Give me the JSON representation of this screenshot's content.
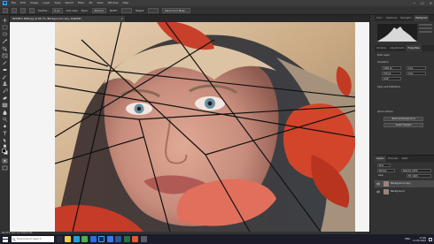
{
  "menubar": {
    "logo": "Ps",
    "items": [
      "File",
      "Edit",
      "Image",
      "Layer",
      "Type",
      "Select",
      "Filter",
      "3D",
      "View",
      "Window",
      "Help"
    ],
    "window_controls": [
      "─",
      "☐",
      "✕"
    ]
  },
  "options": {
    "feather": "Feather:",
    "feather_value": "0 px",
    "anti_alias": "Anti-alias",
    "style_label": "Style:",
    "style_value": "Normal",
    "width_label": "Width:",
    "height_label": "Height:",
    "select_mask": "Select and Mask..."
  },
  "document": {
    "tab_label": "MODELS NEW.jpg @ 66.7% (Background copy, RGB/8#)",
    "close": "×"
  },
  "status": {
    "text": "66.67%   Doc: 6.17M/12.3M"
  },
  "panels": {
    "top_tabs": [
      "Color",
      "Swatches",
      "Navigator",
      "Histogram"
    ],
    "mid_tabs": [
      "Libraries",
      "Adjustments",
      "Properties"
    ],
    "properties_title": "Pixel Layer",
    "transform_label": "Transform",
    "w_value": "1280 px",
    "h_value": "720 px",
    "x_value": "0 px",
    "y_value": "0 px",
    "angle_value": "0.00°",
    "align_label": "Align and Distribute",
    "quick_actions": "Quick Actions",
    "remove_bg": "Remove Background",
    "select_subject": "Select Subject"
  },
  "layers": {
    "tabs": [
      "Layers",
      "Channels",
      "Paths"
    ],
    "kind": "Kind",
    "blend": "Normal",
    "opacity": "Opacity: 100%",
    "lock": "Lock:",
    "fill": "Fill: 100%",
    "rows": [
      {
        "name": "Background copy"
      },
      {
        "name": "Background"
      }
    ]
  },
  "taskbar": {
    "search_placeholder": "Type here to search",
    "time": "17:46",
    "date": "11-03-2022",
    "lang": "ENG",
    "apps": [
      {
        "icon": "task-view-icon",
        "color": "#2b2b3a"
      },
      {
        "icon": "file-explorer-icon",
        "color": "#f2c94c"
      },
      {
        "icon": "edge-icon",
        "color": "#1fa3d4"
      },
      {
        "icon": "chrome-icon",
        "color": "#4caf50"
      },
      {
        "icon": "mail-icon",
        "color": "#2a6fdb"
      },
      {
        "icon": "photoshop-icon",
        "color": "#0b2a4a"
      },
      {
        "icon": "store-icon",
        "color": "#3b78e7"
      },
      {
        "icon": "word-icon",
        "color": "#2b579a"
      },
      {
        "icon": "excel-icon",
        "color": "#217346"
      },
      {
        "icon": "media-icon",
        "color": "#e05a2b"
      },
      {
        "icon": "settings-icon",
        "color": "#5a5a6a"
      }
    ]
  }
}
